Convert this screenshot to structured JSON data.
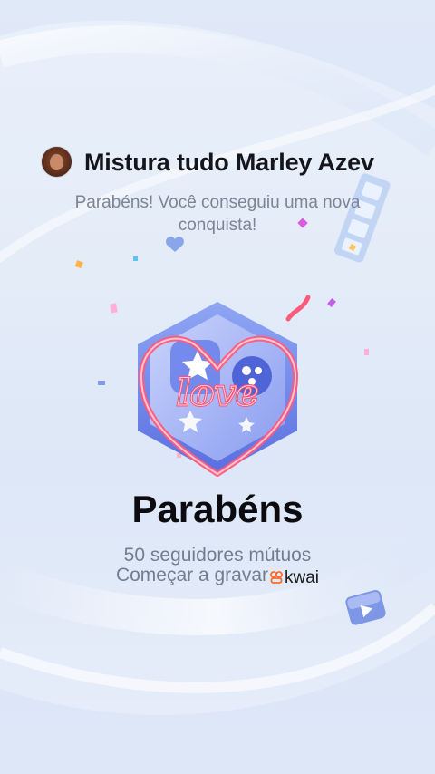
{
  "header": {
    "avatar_icon": "user-avatar",
    "username": "Mistura tudo Marley Azev"
  },
  "congrats_message": "Parabéns! Você conseguiu uma nova conquista!",
  "badge": {
    "icon": "love-achievement-badge",
    "text": "love"
  },
  "achievement": {
    "title": "Parabéns",
    "description": "50 seguidores mútuos",
    "cta_prefix": "Começar a gravar",
    "brand": "kwai"
  },
  "colors": {
    "background": "#e4ecf8",
    "badge_blue": "#6b7fe8",
    "neon_pink": "#ff5a7a",
    "title_text": "#0c0c10",
    "muted_text": "#747d8e"
  }
}
